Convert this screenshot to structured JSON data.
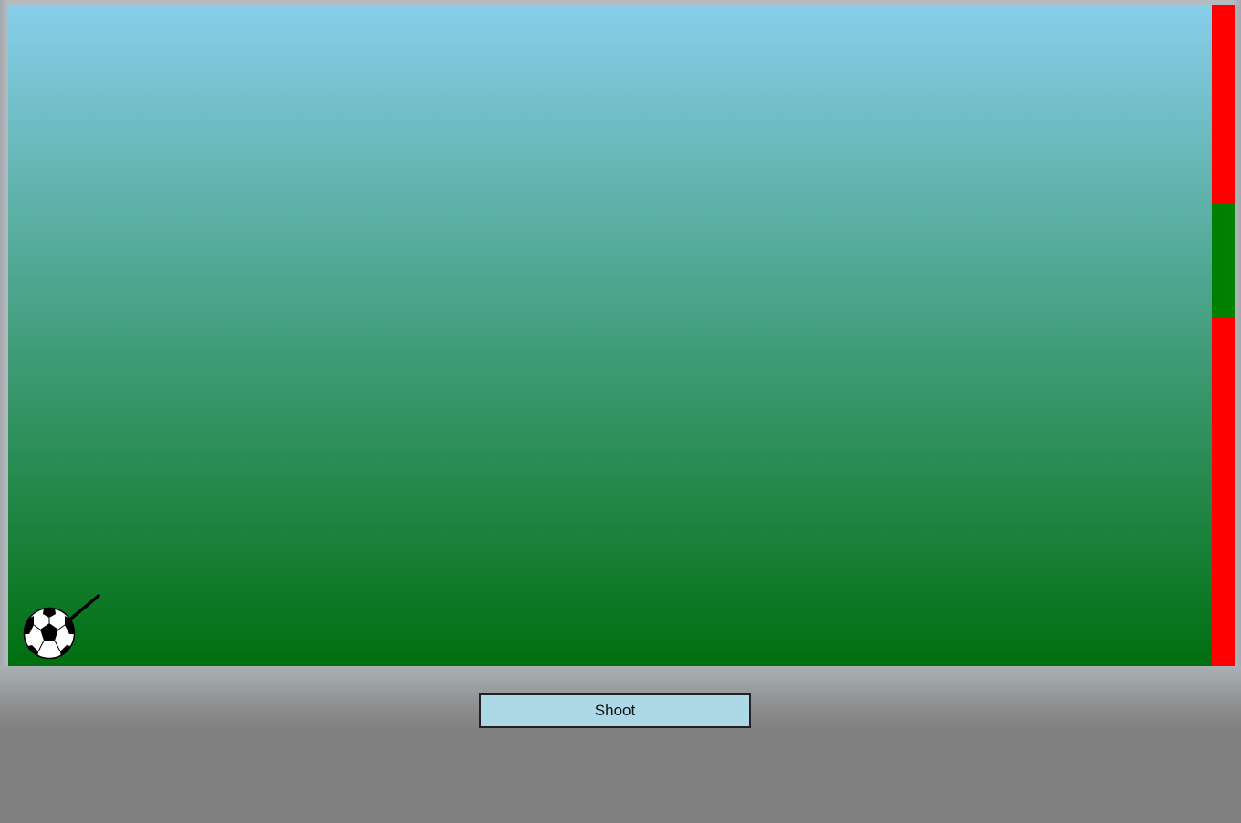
{
  "controls": {
    "shoot_label": "Shoot"
  },
  "colors": {
    "sky": "#87ceeb",
    "grass": "#006f10",
    "goal_miss_zone": "#ff0000",
    "goal_target_zone": "#008000",
    "button_bg": "#add8e6",
    "page_bg": "#808080"
  },
  "icons": {
    "ball": "soccer-ball-icon",
    "aim": "aim-line"
  }
}
